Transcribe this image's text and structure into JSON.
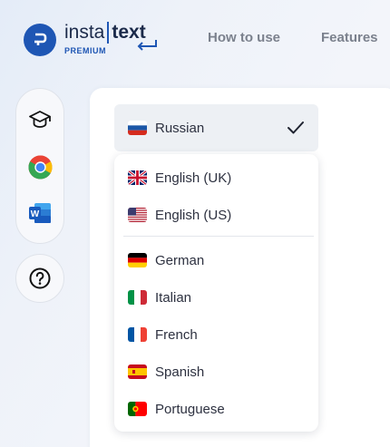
{
  "header": {
    "logo": {
      "word_left": "insta",
      "word_right": "text",
      "badge": "PREMIUM"
    },
    "nav": [
      {
        "label": "How to use"
      },
      {
        "label": "Features"
      }
    ]
  },
  "sidebar": {
    "items": [
      {
        "icon": "graduation-cap-icon"
      },
      {
        "icon": "chrome-icon"
      },
      {
        "icon": "word-icon"
      }
    ],
    "help_icon": "question-circle-icon"
  },
  "language_selector": {
    "selected": {
      "label": "Russian",
      "flag": "ru"
    },
    "options_top": [
      {
        "label": "English (UK)",
        "flag": "gb"
      },
      {
        "label": "English (US)",
        "flag": "us"
      }
    ],
    "options": [
      {
        "label": "German",
        "flag": "de"
      },
      {
        "label": "Italian",
        "flag": "it"
      },
      {
        "label": "French",
        "flag": "fr"
      },
      {
        "label": "Spanish",
        "flag": "es"
      },
      {
        "label": "Portuguese",
        "flag": "pt"
      }
    ]
  },
  "colors": {
    "brand_blue": "#1e56b4",
    "selected_bg": "#edf0f4",
    "nav_text": "#7b818d"
  }
}
